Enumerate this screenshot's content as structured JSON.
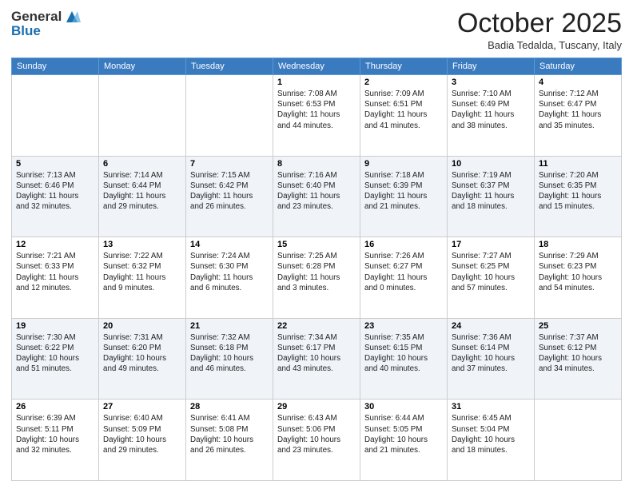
{
  "header": {
    "logo": {
      "general": "General",
      "blue": "Blue"
    },
    "month": "October 2025",
    "location": "Badia Tedalda, Tuscany, Italy"
  },
  "weekdays": [
    "Sunday",
    "Monday",
    "Tuesday",
    "Wednesday",
    "Thursday",
    "Friday",
    "Saturday"
  ],
  "weeks": [
    [
      {
        "day": "",
        "info": ""
      },
      {
        "day": "",
        "info": ""
      },
      {
        "day": "",
        "info": ""
      },
      {
        "day": "1",
        "info": "Sunrise: 7:08 AM\nSunset: 6:53 PM\nDaylight: 11 hours\nand 44 minutes."
      },
      {
        "day": "2",
        "info": "Sunrise: 7:09 AM\nSunset: 6:51 PM\nDaylight: 11 hours\nand 41 minutes."
      },
      {
        "day": "3",
        "info": "Sunrise: 7:10 AM\nSunset: 6:49 PM\nDaylight: 11 hours\nand 38 minutes."
      },
      {
        "day": "4",
        "info": "Sunrise: 7:12 AM\nSunset: 6:47 PM\nDaylight: 11 hours\nand 35 minutes."
      }
    ],
    [
      {
        "day": "5",
        "info": "Sunrise: 7:13 AM\nSunset: 6:46 PM\nDaylight: 11 hours\nand 32 minutes."
      },
      {
        "day": "6",
        "info": "Sunrise: 7:14 AM\nSunset: 6:44 PM\nDaylight: 11 hours\nand 29 minutes."
      },
      {
        "day": "7",
        "info": "Sunrise: 7:15 AM\nSunset: 6:42 PM\nDaylight: 11 hours\nand 26 minutes."
      },
      {
        "day": "8",
        "info": "Sunrise: 7:16 AM\nSunset: 6:40 PM\nDaylight: 11 hours\nand 23 minutes."
      },
      {
        "day": "9",
        "info": "Sunrise: 7:18 AM\nSunset: 6:39 PM\nDaylight: 11 hours\nand 21 minutes."
      },
      {
        "day": "10",
        "info": "Sunrise: 7:19 AM\nSunset: 6:37 PM\nDaylight: 11 hours\nand 18 minutes."
      },
      {
        "day": "11",
        "info": "Sunrise: 7:20 AM\nSunset: 6:35 PM\nDaylight: 11 hours\nand 15 minutes."
      }
    ],
    [
      {
        "day": "12",
        "info": "Sunrise: 7:21 AM\nSunset: 6:33 PM\nDaylight: 11 hours\nand 12 minutes."
      },
      {
        "day": "13",
        "info": "Sunrise: 7:22 AM\nSunset: 6:32 PM\nDaylight: 11 hours\nand 9 minutes."
      },
      {
        "day": "14",
        "info": "Sunrise: 7:24 AM\nSunset: 6:30 PM\nDaylight: 11 hours\nand 6 minutes."
      },
      {
        "day": "15",
        "info": "Sunrise: 7:25 AM\nSunset: 6:28 PM\nDaylight: 11 hours\nand 3 minutes."
      },
      {
        "day": "16",
        "info": "Sunrise: 7:26 AM\nSunset: 6:27 PM\nDaylight: 11 hours\nand 0 minutes."
      },
      {
        "day": "17",
        "info": "Sunrise: 7:27 AM\nSunset: 6:25 PM\nDaylight: 10 hours\nand 57 minutes."
      },
      {
        "day": "18",
        "info": "Sunrise: 7:29 AM\nSunset: 6:23 PM\nDaylight: 10 hours\nand 54 minutes."
      }
    ],
    [
      {
        "day": "19",
        "info": "Sunrise: 7:30 AM\nSunset: 6:22 PM\nDaylight: 10 hours\nand 51 minutes."
      },
      {
        "day": "20",
        "info": "Sunrise: 7:31 AM\nSunset: 6:20 PM\nDaylight: 10 hours\nand 49 minutes."
      },
      {
        "day": "21",
        "info": "Sunrise: 7:32 AM\nSunset: 6:18 PM\nDaylight: 10 hours\nand 46 minutes."
      },
      {
        "day": "22",
        "info": "Sunrise: 7:34 AM\nSunset: 6:17 PM\nDaylight: 10 hours\nand 43 minutes."
      },
      {
        "day": "23",
        "info": "Sunrise: 7:35 AM\nSunset: 6:15 PM\nDaylight: 10 hours\nand 40 minutes."
      },
      {
        "day": "24",
        "info": "Sunrise: 7:36 AM\nSunset: 6:14 PM\nDaylight: 10 hours\nand 37 minutes."
      },
      {
        "day": "25",
        "info": "Sunrise: 7:37 AM\nSunset: 6:12 PM\nDaylight: 10 hours\nand 34 minutes."
      }
    ],
    [
      {
        "day": "26",
        "info": "Sunrise: 6:39 AM\nSunset: 5:11 PM\nDaylight: 10 hours\nand 32 minutes."
      },
      {
        "day": "27",
        "info": "Sunrise: 6:40 AM\nSunset: 5:09 PM\nDaylight: 10 hours\nand 29 minutes."
      },
      {
        "day": "28",
        "info": "Sunrise: 6:41 AM\nSunset: 5:08 PM\nDaylight: 10 hours\nand 26 minutes."
      },
      {
        "day": "29",
        "info": "Sunrise: 6:43 AM\nSunset: 5:06 PM\nDaylight: 10 hours\nand 23 minutes."
      },
      {
        "day": "30",
        "info": "Sunrise: 6:44 AM\nSunset: 5:05 PM\nDaylight: 10 hours\nand 21 minutes."
      },
      {
        "day": "31",
        "info": "Sunrise: 6:45 AM\nSunset: 5:04 PM\nDaylight: 10 hours\nand 18 minutes."
      },
      {
        "day": "",
        "info": ""
      }
    ]
  ]
}
